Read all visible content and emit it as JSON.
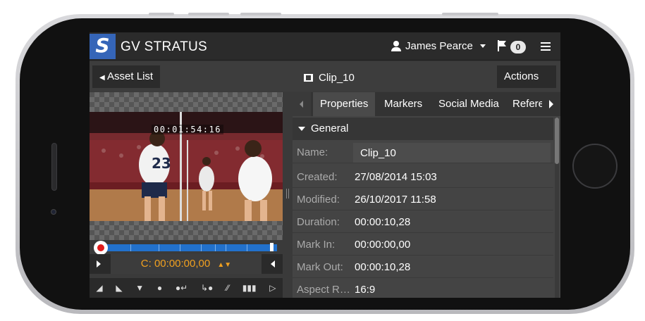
{
  "app": {
    "brand": "GV STRATUS",
    "logo_letter": "S"
  },
  "header": {
    "user_name": "James Pearce",
    "notifications_count": "0"
  },
  "titlebar": {
    "back_label": "Asset List",
    "clip_title": "Clip_10",
    "actions_label": "Actions"
  },
  "player": {
    "overlay_timecode": "00:01:54:16",
    "timecode_field": "C:  00:00:00,00"
  },
  "tabs": [
    "Properties",
    "Markers",
    "Social Media",
    "Refere"
  ],
  "panel": {
    "section_title": "General",
    "name_label": "Name:",
    "name_value": "Clip_10",
    "properties": [
      {
        "label": "Created:",
        "value": "27/08/2014 15:03"
      },
      {
        "label": "Modified:",
        "value": "26/10/2017 11:58"
      },
      {
        "label": "Duration:",
        "value": "00:00:10,28"
      },
      {
        "label": "Mark In:",
        "value": "00:00:00,00"
      },
      {
        "label": "Mark Out:",
        "value": "00:00:10,28"
      },
      {
        "label": "Aspect Ra...",
        "value": "16:9"
      }
    ]
  },
  "colors": {
    "accent": "#3565b8",
    "timeline": "#2271cc",
    "timecode": "#f0a020",
    "record": "#e01c1c"
  }
}
